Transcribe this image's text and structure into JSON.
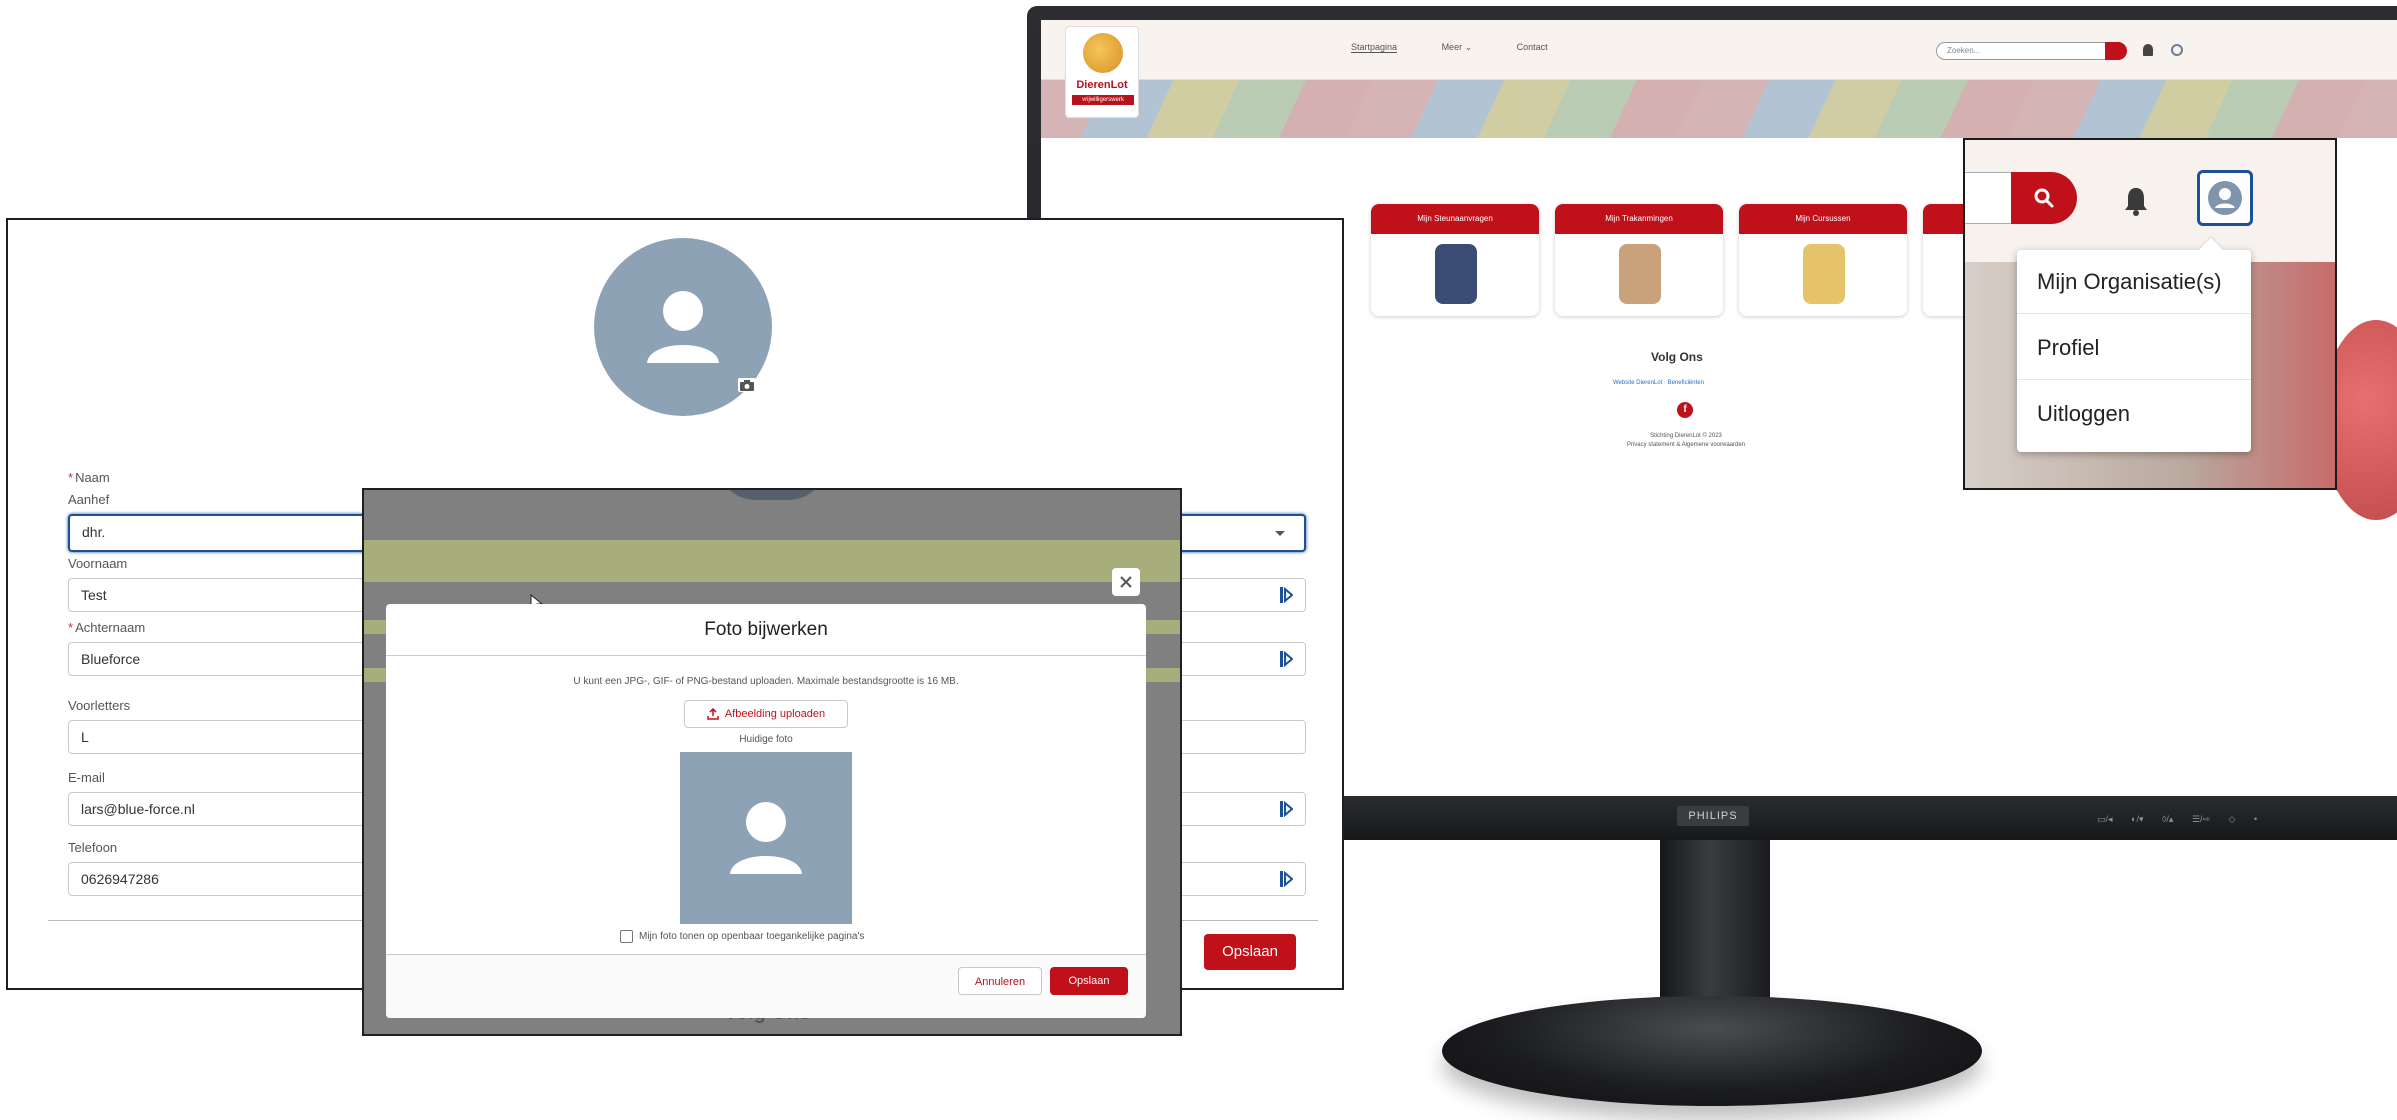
{
  "site": {
    "logo_name": "DierenLot",
    "logo_tag": "vrijwilligerswerk",
    "nav": [
      "Startpagina",
      "Meer ⌄",
      "Contact"
    ],
    "search_placeholder": "Zoeken...",
    "cards": [
      "Mijn Steunaanvragen",
      "Mijn Trakanmingen",
      "Mijn Cursussen"
    ],
    "volg_ons": "Volg Ons",
    "volg_links": "Website DierenLot · Beneficiënten",
    "footer_line1": "Stichting DierenLot © 2023",
    "footer_line2": "Privacy statement & Algemene voorwaarden"
  },
  "zoom_menu": {
    "items": [
      "Mijn Organisatie(s)",
      "Profiel",
      "Uitloggen"
    ]
  },
  "profile": {
    "naam_label": "Naam",
    "aanhef_label": "Aanhef",
    "aanhef_value": "dhr.",
    "voornaam_label": "Voornaam",
    "voornaam_value": "Test",
    "achternaam_label": "Achternaam",
    "achternaam_value": "Blueforce",
    "voorletters_label": "Voorletters",
    "voorletters_value": "L",
    "email_label": "E-mail",
    "email_value": "lars@blue-force.nl",
    "telefoon_label": "Telefoon",
    "telefoon_value": "0626947286",
    "save_label": "Opslaan"
  },
  "photo_modal": {
    "title": "Foto bijwerken",
    "description": "U kunt een JPG-, GIF- of PNG-bestand uploaden. Maximale bestandsgrootte is 16 MB.",
    "upload_label": "Afbeelding uploaden",
    "current_label": "Huidige foto",
    "checkbox_label": "Mijn foto tonen op openbaar toegankelijke pagina's",
    "cancel_label": "Annuleren",
    "save_label": "Opslaan",
    "background_text": "Volg Ons"
  },
  "monitor": {
    "brand": "PHILIPS",
    "buttons": "▭/◂ ◐/▾ ◊/▴ ☰/⇨ ◇ •"
  },
  "colors": {
    "brand_red": "#c0101a",
    "focus_blue": "#1b5297",
    "avatar_gray": "#8ea2b6"
  }
}
